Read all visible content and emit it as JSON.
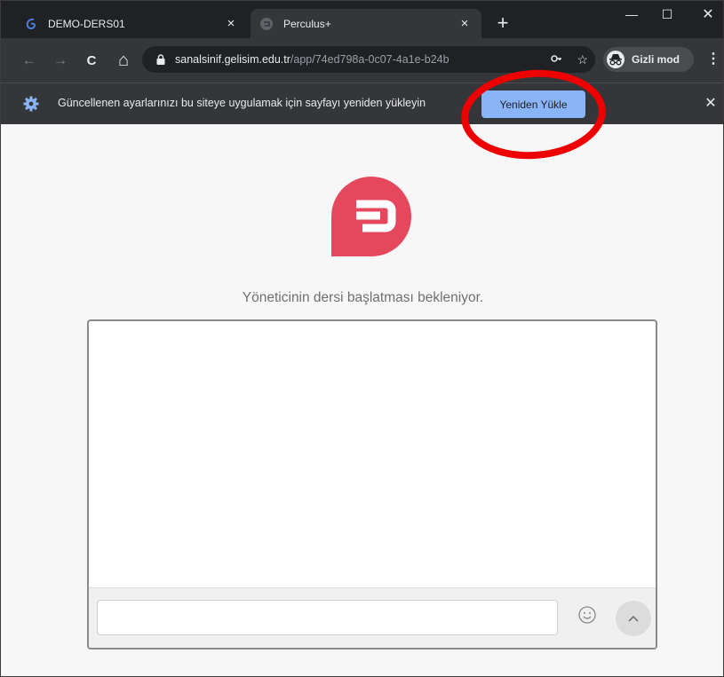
{
  "browser": {
    "tabs": [
      {
        "title": "DEMO-DERS01",
        "icon": "gelisim-logo-icon",
        "close": "×",
        "active": false
      },
      {
        "title": "Perculus+",
        "icon": "perculus-favicon-icon",
        "close": "×",
        "active": true
      }
    ],
    "new_tab": "+",
    "window_controls": {
      "minimize": "—",
      "maximize": "☐",
      "close": "✕"
    },
    "nav": {
      "back": "←",
      "forward": "→",
      "reload": "C",
      "home": "⌂"
    },
    "address": {
      "host": "sanalsinif.gelisim.edu.tr",
      "path": "/app/74ed798a-0c07-4a1e-b24b"
    },
    "omni_icons": {
      "bookmark": "☆"
    },
    "incognito_label": "Gizli mod",
    "menu": "⋮"
  },
  "infobar": {
    "message": "Güncellenen ayarlarınızı bu siteye uygulamak için sayfayı yeniden yükleyin",
    "button_label": "Yeniden Yükle",
    "close": "✕"
  },
  "annotation": {
    "color": "#ee0000"
  },
  "page": {
    "status_text": "Yöneticinin dersi başlatması bekleniyor.",
    "chat_input_placeholder": "",
    "brand_color": "#e5475c"
  }
}
